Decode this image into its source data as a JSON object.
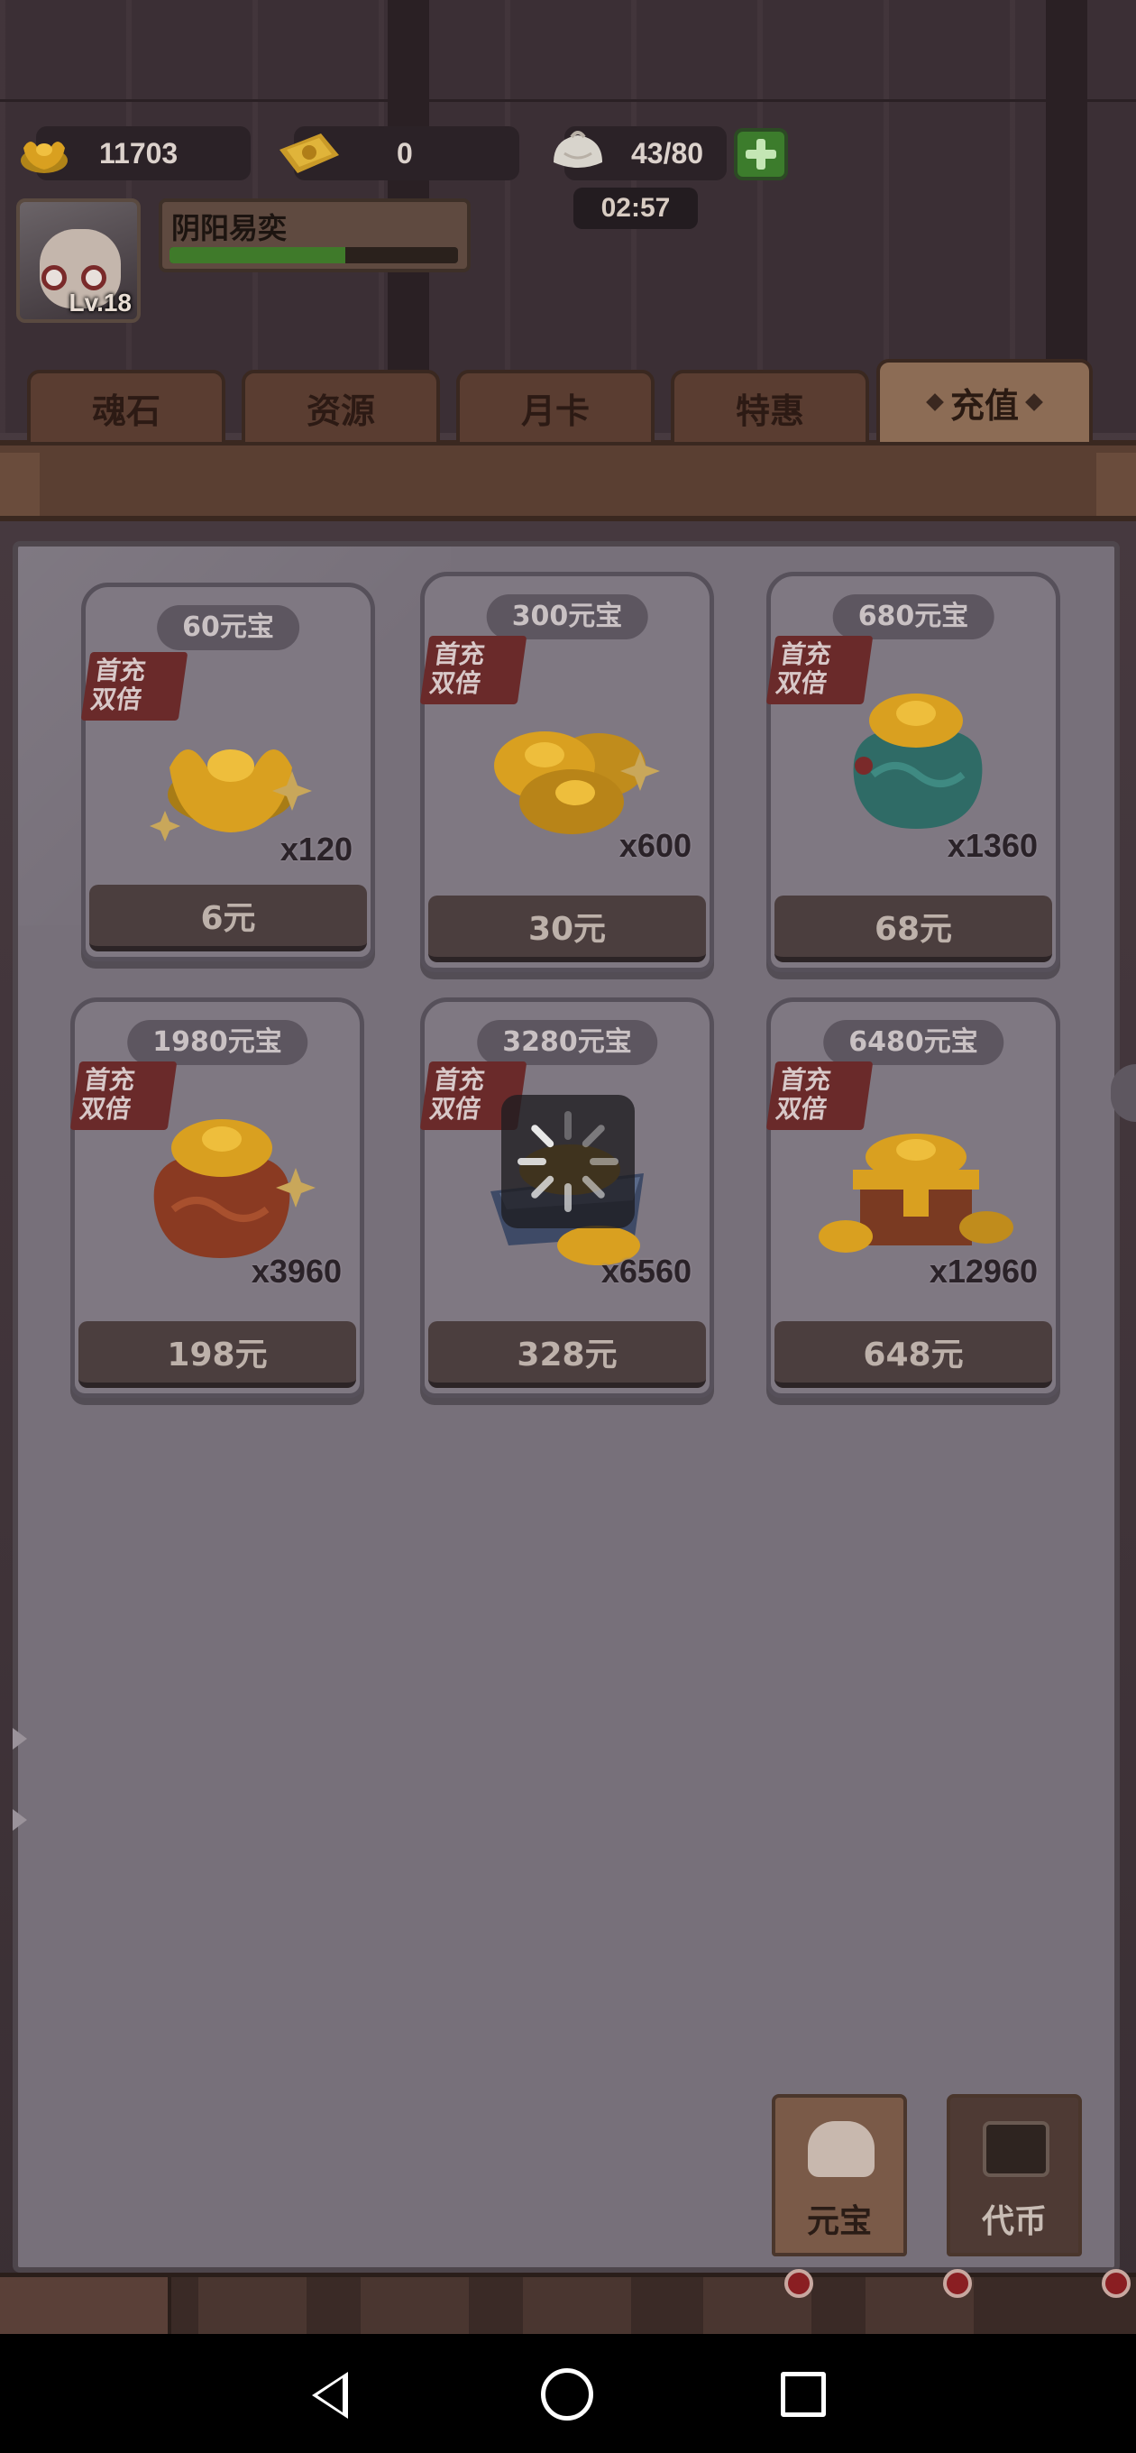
{
  "resources": {
    "gold": "11703",
    "ticket": "0",
    "stamina": "43/80",
    "timer": "02:57"
  },
  "player": {
    "name": "阴阳易奕",
    "level": "Lv.18",
    "xp_progress": 0.61
  },
  "tabs": [
    {
      "label": "魂石",
      "active": false
    },
    {
      "label": "资源",
      "active": false
    },
    {
      "label": "月卡",
      "active": false
    },
    {
      "label": "特惠",
      "active": false
    },
    {
      "label": "充值",
      "active": true
    }
  ],
  "offers": [
    {
      "amount": "60元宝",
      "badge_line1": "首充",
      "badge_line2": "双倍",
      "count": "x120",
      "price": "6元",
      "icon": "single-ingot-icon"
    },
    {
      "amount": "300元宝",
      "badge_line1": "首充",
      "badge_line2": "双倍",
      "count": "x600",
      "price": "30元",
      "icon": "ingot-pile-icon"
    },
    {
      "amount": "680元宝",
      "badge_line1": "首充",
      "badge_line2": "双倍",
      "count": "x1360",
      "price": "68元",
      "icon": "teal-money-bag-icon"
    },
    {
      "amount": "1980元宝",
      "badge_line1": "首充",
      "badge_line2": "双倍",
      "count": "x3960",
      "price": "198元",
      "icon": "red-money-bag-icon"
    },
    {
      "amount": "3280元宝",
      "badge_line1": "首充",
      "badge_line2": "双倍",
      "count": "x6560",
      "price": "328元",
      "icon": "ingot-cart-icon"
    },
    {
      "amount": "6480元宝",
      "badge_line1": "首充",
      "badge_line2": "双倍",
      "count": "x12960",
      "price": "648元",
      "icon": "treasure-chest-icon"
    }
  ],
  "currency_tabs": [
    {
      "label": "元宝",
      "icon": "ingot-icon"
    },
    {
      "label": "代币",
      "icon": "token-icon"
    }
  ],
  "colors": {
    "accent_green": "#3c7c2c",
    "badge_red": "#6a2a2a",
    "gold": "#d9a020"
  }
}
